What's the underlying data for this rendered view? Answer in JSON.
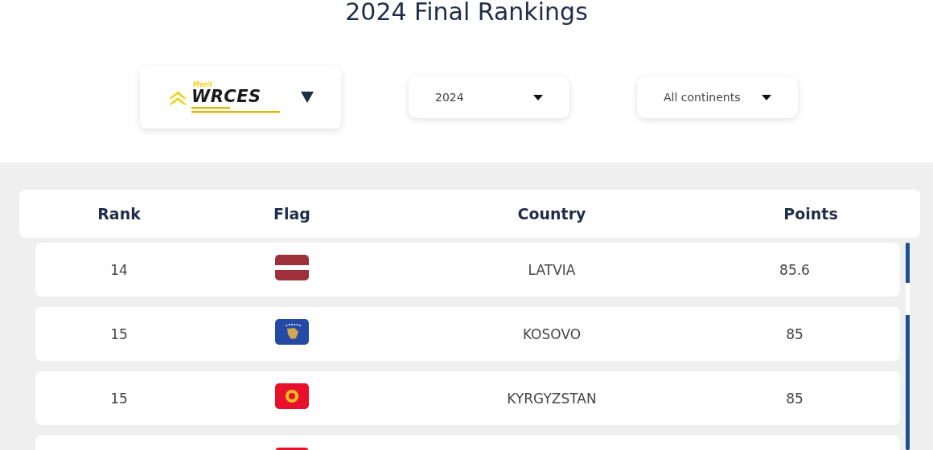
{
  "title": "2024 Final Rankings",
  "logo": {
    "kicker": "Merit",
    "name": "WRCES"
  },
  "filters": [
    {
      "value": "2024"
    },
    {
      "value": "All continents"
    }
  ],
  "table": {
    "columns": [
      "Rank",
      "Flag",
      "Country",
      "Points"
    ],
    "rows": [
      {
        "rank": "14",
        "kind": "latvia",
        "country": "LATVIA",
        "points": "85.6"
      },
      {
        "rank": "15",
        "kind": "kosovo",
        "country": "KOSOVO",
        "points": "85"
      },
      {
        "rank": "15",
        "kind": "kyrgyzstan",
        "country": "KYRGYZSTAN",
        "points": "85"
      },
      {
        "kind": "red"
      }
    ]
  }
}
